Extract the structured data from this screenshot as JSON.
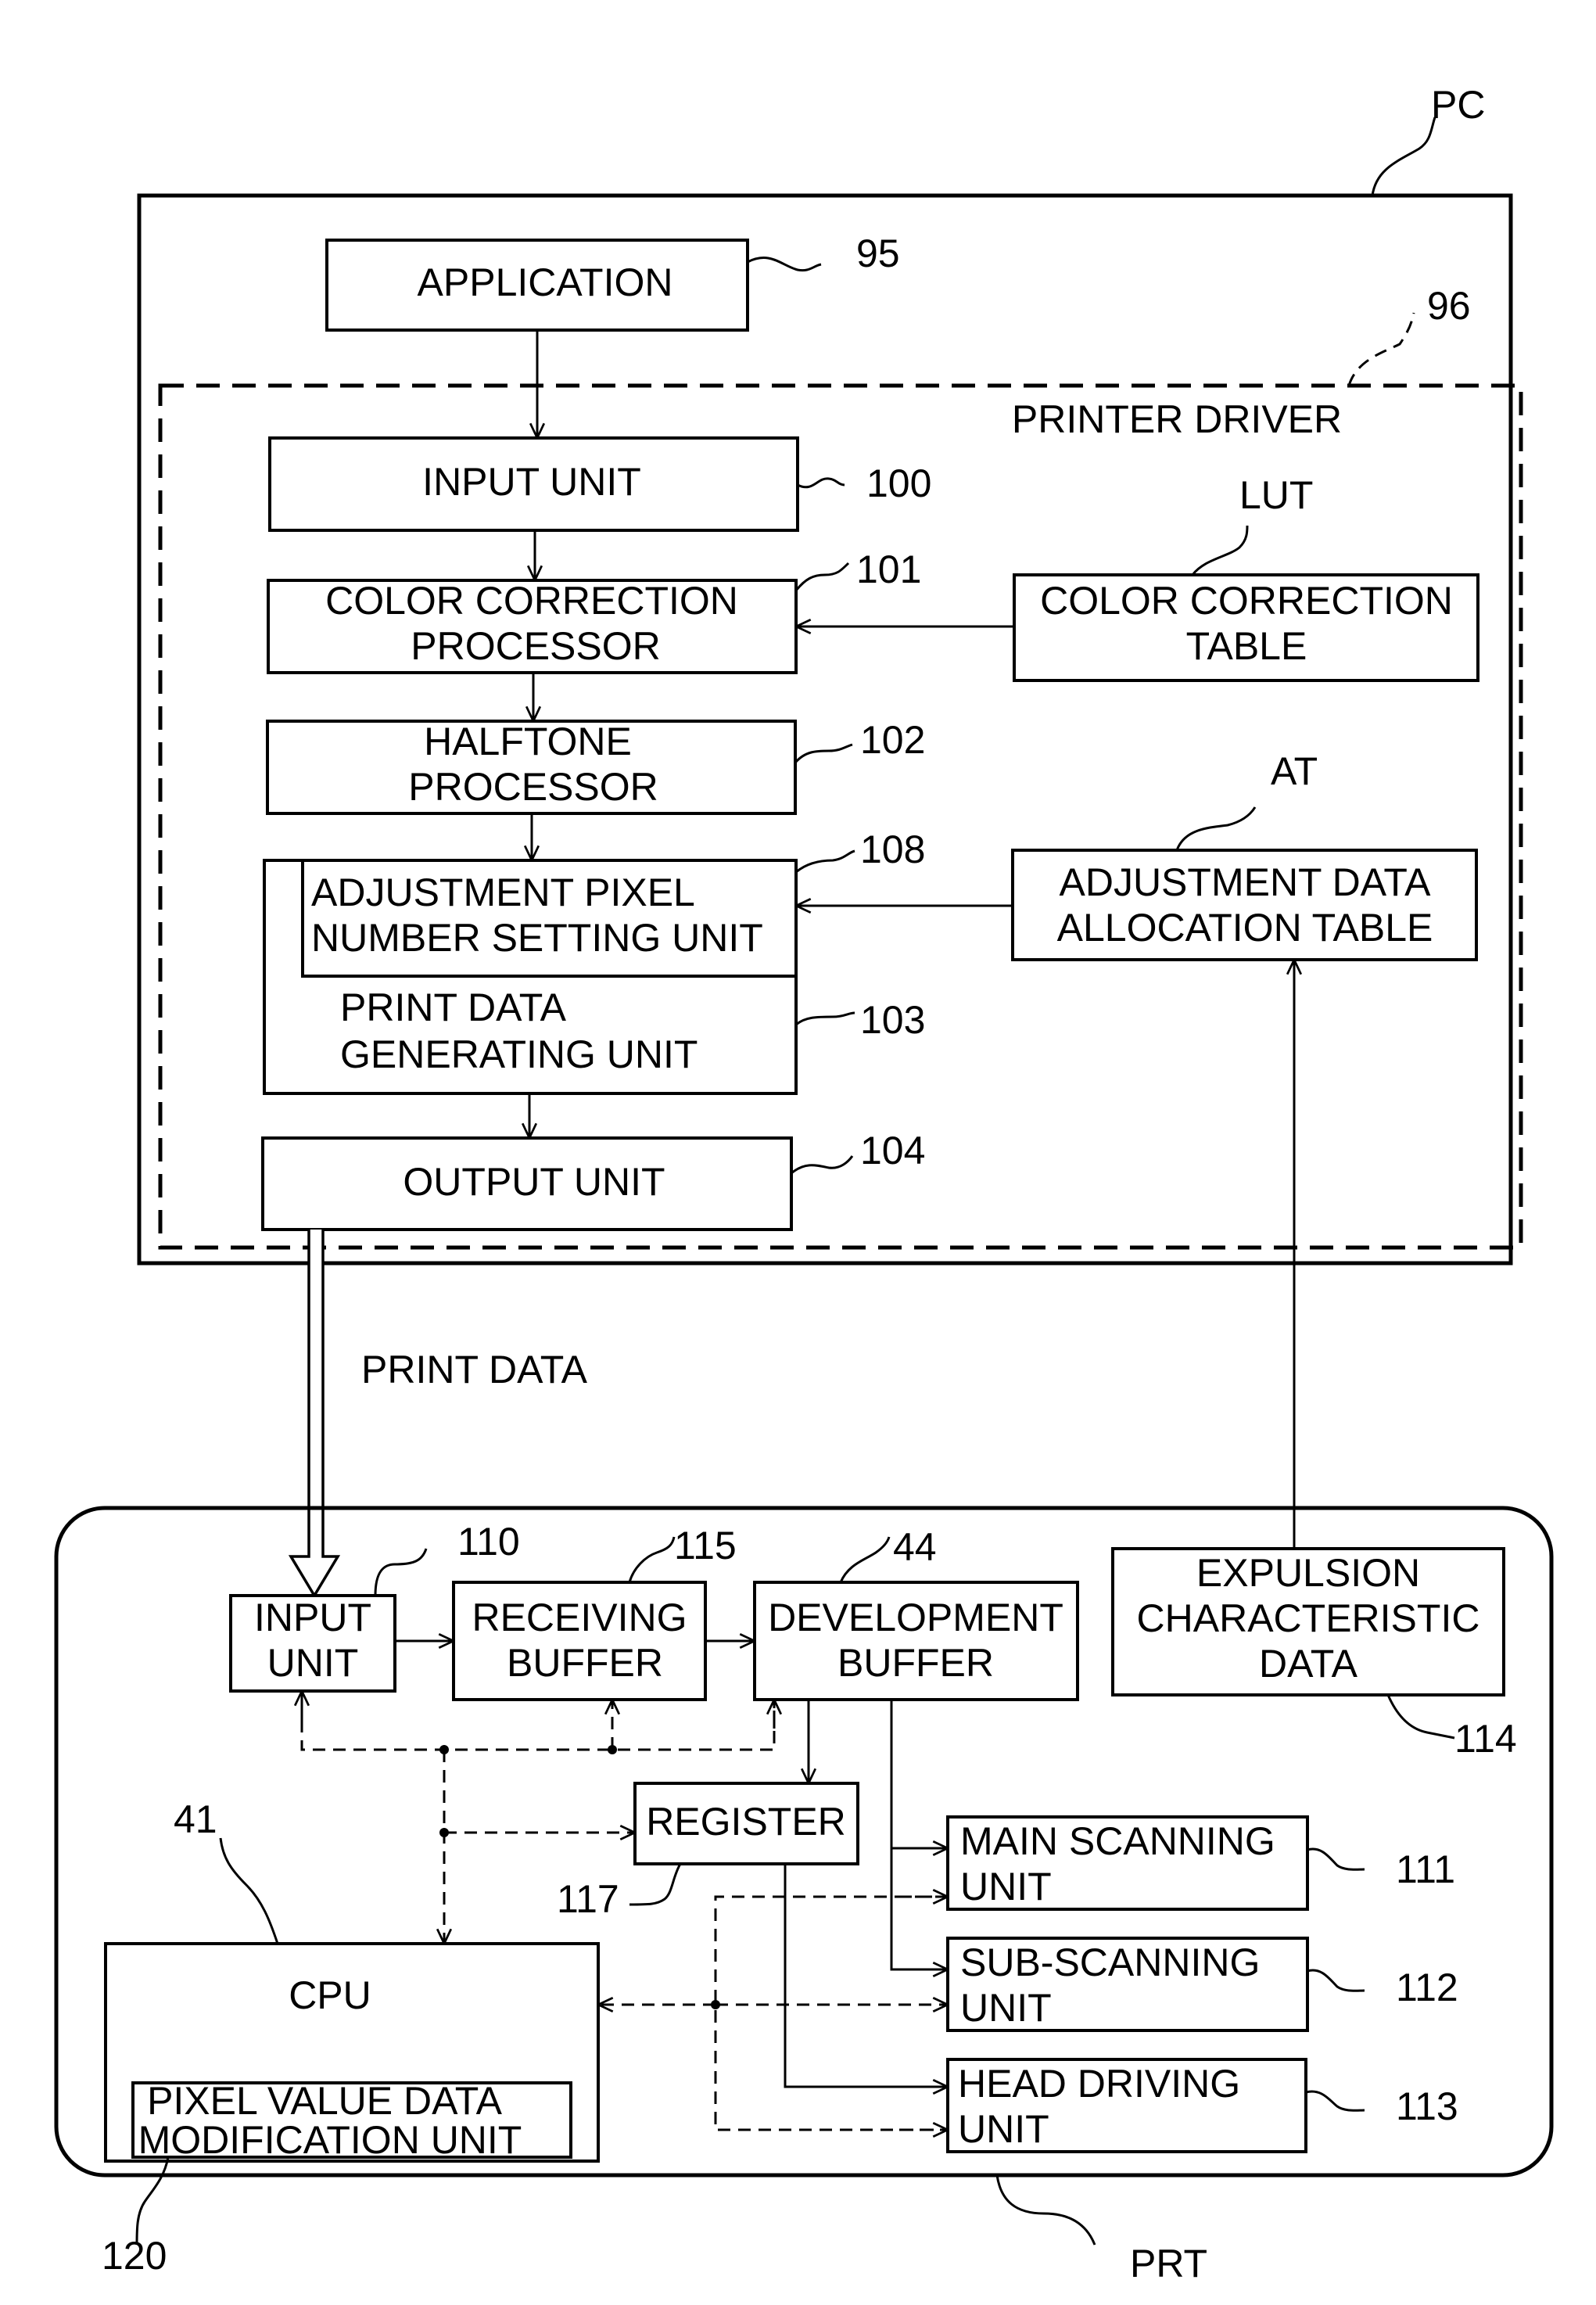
{
  "figure": {
    "pc_label": "PC",
    "prt_label": "PRT",
    "printer_driver_label": "PRINTER DRIVER",
    "print_data_label": "PRINT DATA"
  },
  "pc_blocks": {
    "application": {
      "lines": [
        "APPLICATION"
      ],
      "ref": "95"
    },
    "printer_driver_ref": "96",
    "input_unit": {
      "lines": [
        "INPUT UNIT"
      ],
      "ref": "100"
    },
    "color_correction_processor": {
      "lines": [
        "COLOR CORRECTION",
        "PROCESSOR"
      ],
      "ref": "101"
    },
    "halftone_processor": {
      "lines": [
        "HALFTONE",
        "PROCESSOR"
      ],
      "ref": "102"
    },
    "adjustment_pixel_number_setting_unit": {
      "lines": [
        "ADJUSTMENT PIXEL",
        "NUMBER SETTING UNIT"
      ],
      "ref": "108"
    },
    "print_data_generating_unit": {
      "lines": [
        "PRINT DATA",
        "GENERATING UNIT"
      ],
      "ref": "103"
    },
    "output_unit": {
      "lines": [
        "OUTPUT UNIT"
      ],
      "ref": "104"
    },
    "color_correction_table": {
      "lines": [
        "COLOR CORRECTION",
        "TABLE"
      ],
      "ref": "LUT"
    },
    "adjustment_data_allocation_table": {
      "lines": [
        "ADJUSTMENT DATA",
        "ALLOCATION TABLE"
      ],
      "ref": "AT"
    }
  },
  "printer_blocks": {
    "input_unit": {
      "lines": [
        "INPUT",
        "UNIT"
      ],
      "ref": "110"
    },
    "receiving_buffer": {
      "lines": [
        "RECEIVING",
        "BUFFER"
      ],
      "ref": "115"
    },
    "development_buffer": {
      "lines": [
        "DEVELOPMENT",
        "BUFFER"
      ],
      "ref": "44"
    },
    "expulsion_characteristic_data": {
      "lines": [
        "EXPULSION",
        "CHARACTERISTIC",
        "DATA"
      ],
      "ref": "114"
    },
    "register": {
      "lines": [
        "REGISTER"
      ],
      "ref": "117"
    },
    "main_scanning_unit": {
      "lines": [
        "MAIN SCANNING",
        "UNIT"
      ],
      "ref": "111"
    },
    "sub_scanning_unit": {
      "lines": [
        "SUB-SCANNING",
        "UNIT"
      ],
      "ref": "112"
    },
    "head_driving_unit": {
      "lines": [
        "HEAD DRIVING",
        "UNIT"
      ],
      "ref": "113"
    },
    "cpu": {
      "lines": [
        "CPU"
      ],
      "ref": "41"
    },
    "pixel_value_data_modification_unit": {
      "lines": [
        "PIXEL VALUE DATA",
        "MODIFICATION UNIT"
      ],
      "ref": "120"
    }
  }
}
